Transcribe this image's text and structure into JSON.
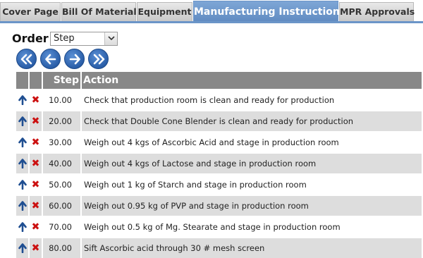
{
  "tabs": [
    {
      "label": "Cover Page",
      "active": false
    },
    {
      "label": "Bill Of Materials",
      "active": false
    },
    {
      "label": "Equipment",
      "active": false
    },
    {
      "label": "Manufacturing Instructions",
      "active": true
    },
    {
      "label": "MPR Approvals",
      "active": false
    }
  ],
  "order": {
    "label": "Order",
    "selected": "Step"
  },
  "nav_icons": [
    "first-page-icon",
    "previous-page-icon",
    "next-page-icon",
    "last-page-icon"
  ],
  "table": {
    "headers": {
      "step": "Step",
      "action": "Action"
    },
    "rows": [
      {
        "step": "10.00",
        "action": "Check that production room is clean and ready for production"
      },
      {
        "step": "20.00",
        "action": "Check that Double Cone Blender is clean and ready for production"
      },
      {
        "step": "30.00",
        "action": "Weigh out 4 kgs of Ascorbic Acid and stage in production room"
      },
      {
        "step": "40.00",
        "action": "Weigh out 4 kgs of Lactose and stage in production room"
      },
      {
        "step": "50.00",
        "action": "Weigh out 1 kg of Starch and stage in production room"
      },
      {
        "step": "60.00",
        "action": "Weigh out 0.95 kg of PVP and stage in production room"
      },
      {
        "step": "70.00",
        "action": "Weigh out 0.5 kg of Mg. Stearate and stage in production room"
      },
      {
        "step": "80.00",
        "action": "Sift Ascorbic acid through 30 # mesh screen"
      }
    ]
  },
  "colors": {
    "accent": "#6b95c8",
    "delete": "#cc1111",
    "arrow": "#1f4e91",
    "header": "#888888"
  }
}
